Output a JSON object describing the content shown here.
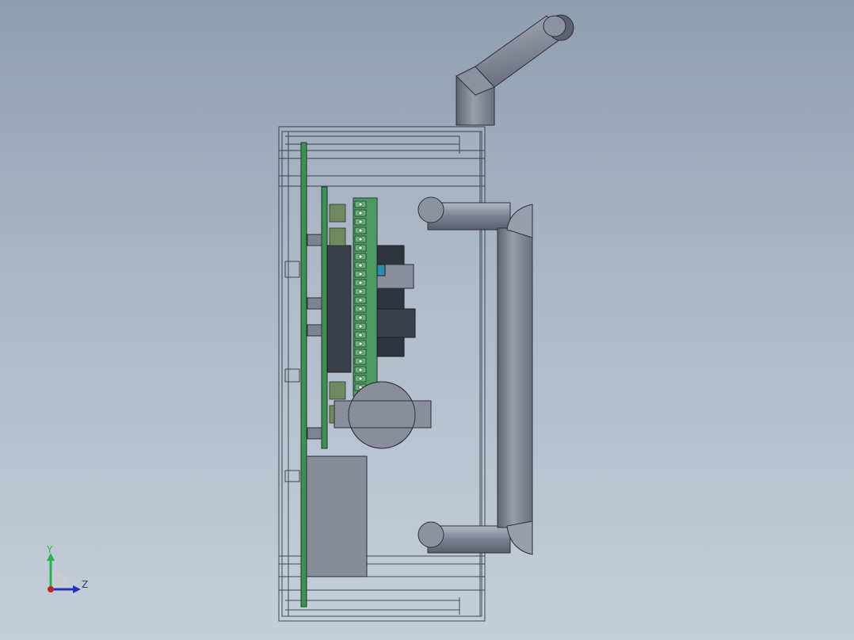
{
  "triad": {
    "y_label": "Y",
    "z_label": "Z",
    "colors": {
      "y_axis": "#2bb34a",
      "z_axis": "#1f36b8",
      "x_origin": "#c0202a"
    }
  },
  "model": {
    "view": "side view",
    "colors": {
      "enclosure_edge": "#2c3038",
      "tube": "#8a8e9b",
      "pcb_green": "#3f8f55",
      "connector": "#3a3f4a",
      "teal_part": "#2a8fa6"
    }
  }
}
